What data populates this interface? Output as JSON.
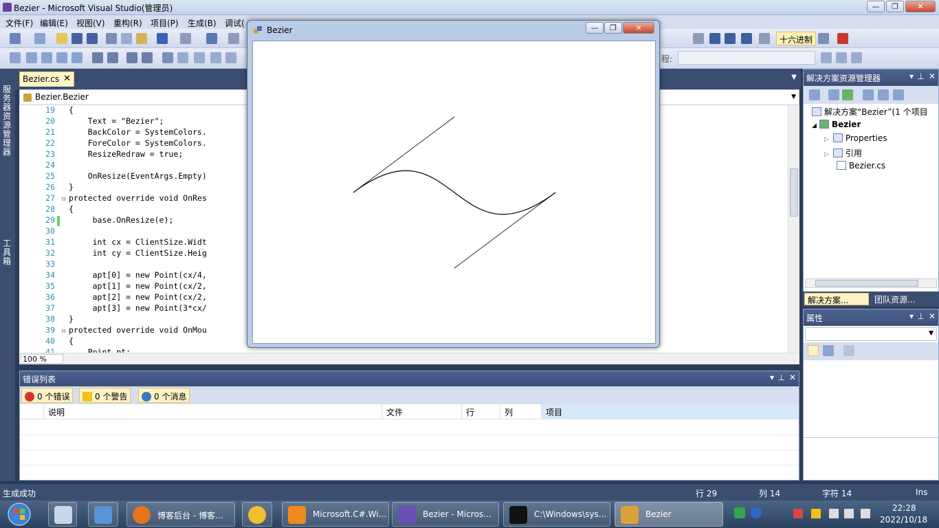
{
  "window": {
    "title": "Bezier - Microsoft Visual Studio(管理员)",
    "min": "—",
    "max": "❐",
    "close": "✕"
  },
  "menu": [
    "文件(F)",
    "编辑(E)",
    "视图(V)",
    "重构(R)",
    "项目(P)",
    "生成(B)",
    "调试("
  ],
  "toolbar": {
    "hex_label": "十六进制",
    "row2_label": "程:"
  },
  "left_strip": {
    "server_explorer": "服务器资源管理器",
    "toolbox": "工具箱"
  },
  "editor": {
    "tab_label": "Bezier.cs",
    "tab_close": "✕",
    "nav_class": "Bezier.Bezier",
    "zoom": "100 %",
    "lines": [
      {
        "n": "19",
        "code": "{"
      },
      {
        "n": "20",
        "code": "    Text = \"Bezier\";"
      },
      {
        "n": "21",
        "code": "    BackColor = SystemColors."
      },
      {
        "n": "22",
        "code": "    ForeColor = SystemColors."
      },
      {
        "n": "23",
        "code": "    ResizeRedraw = true;"
      },
      {
        "n": "24",
        "code": ""
      },
      {
        "n": "25",
        "code": "    OnResize(EventArgs.Empty)"
      },
      {
        "n": "26",
        "code": "}"
      },
      {
        "n": "27",
        "code": "protected override void OnRes"
      },
      {
        "n": "28",
        "code": "{"
      },
      {
        "n": "29",
        "code": "     base.OnResize(e);"
      },
      {
        "n": "30",
        "code": ""
      },
      {
        "n": "31",
        "code": "     int cx = ClientSize.Widt"
      },
      {
        "n": "32",
        "code": "     int cy = ClientSize.Heig"
      },
      {
        "n": "33",
        "code": ""
      },
      {
        "n": "34",
        "code": "     apt[0] = new Point(cx/4,"
      },
      {
        "n": "35",
        "code": "     apt[1] = new Point(cx/2,"
      },
      {
        "n": "36",
        "code": "     apt[2] = new Point(cx/2,"
      },
      {
        "n": "37",
        "code": "     apt[3] = new Point(3*cx/"
      },
      {
        "n": "38",
        "code": "}"
      },
      {
        "n": "39",
        "code": "protected override void OnMou"
      },
      {
        "n": "40",
        "code": "{"
      },
      {
        "n": "41",
        "code": "    Point pt;"
      }
    ]
  },
  "solution": {
    "title": "解决方案资源管理器",
    "root": "解决方案“Bezier”(1 个项目",
    "project": "Bezier",
    "properties": "Properties",
    "references": "引用",
    "file": "Bezier.cs",
    "tab1": "解决方案...",
    "tab2": "团队资源..."
  },
  "properties_panel": {
    "title": "属性"
  },
  "error_list": {
    "title": "错误列表",
    "errors": "0 个错误",
    "warnings": "0 个警告",
    "messages": "0 个消息",
    "col_desc": "说明",
    "col_file": "文件",
    "col_line": "行",
    "col_col": "列",
    "col_project": "项目"
  },
  "status": {
    "text": "生成成功",
    "line": "行 29",
    "col": "列 14",
    "char": "字符 14",
    "ins": "Ins"
  },
  "bezier_window": {
    "title": "Bezier"
  },
  "taskbar": {
    "items": [
      "博客后台 - 博客...",
      "Microsoft.C#.Wi...",
      "Bezier - Micros...",
      "C:\\Windows\\sys...",
      "Bezier"
    ],
    "time": "22:28",
    "date": "2022/10/18"
  }
}
